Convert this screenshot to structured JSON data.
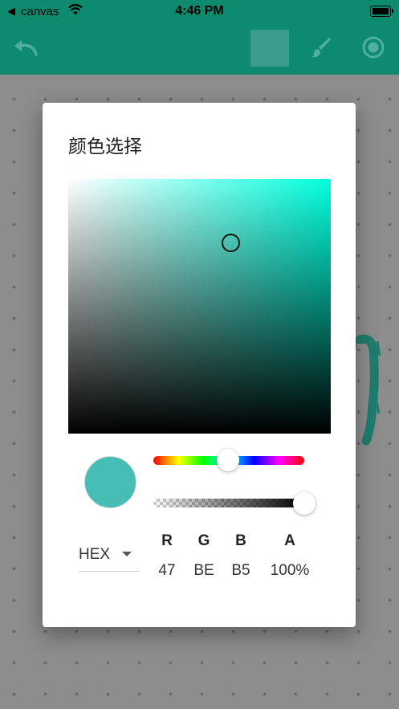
{
  "status_bar": {
    "back_glyph": "◀",
    "carrier": "canvas",
    "time": "4:46 PM"
  },
  "toolbar": {
    "undo_icon": "undo-icon",
    "current_color": "#3a9e8a",
    "brush_icon": "brush-icon",
    "record_icon": "radio-button-icon"
  },
  "colors": {
    "app_bar": "#0e8a6e",
    "selected_color": "#47beb5",
    "stroke_color": "#1f7d6e"
  },
  "dialog": {
    "title": "颜色选择",
    "format": "HEX",
    "channels": [
      {
        "label": "R",
        "value": "47"
      },
      {
        "label": "G",
        "value": "BE"
      },
      {
        "label": "B",
        "value": "B5"
      },
      {
        "label": "A",
        "value": "100%"
      }
    ],
    "hue_position": 0.49,
    "alpha_level": 1.0
  }
}
